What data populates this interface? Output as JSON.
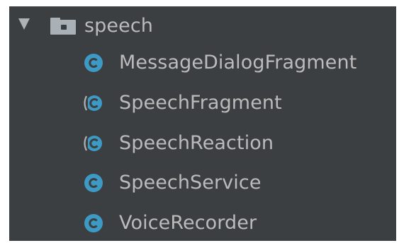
{
  "tree": {
    "folder": {
      "name": "speech",
      "icon": "folder-icon",
      "toggle_icon": "chevron-down-icon"
    },
    "classes": [
      {
        "name": "MessageDialogFragment",
        "icon": "class-icon",
        "abstract": false
      },
      {
        "name": "SpeechFragment",
        "icon": "abstract-class-icon",
        "abstract": true
      },
      {
        "name": "SpeechReaction",
        "icon": "abstract-class-icon",
        "abstract": true
      },
      {
        "name": "SpeechService",
        "icon": "class-icon",
        "abstract": false
      },
      {
        "name": "VoiceRecorder",
        "icon": "class-icon",
        "abstract": false
      }
    ]
  },
  "colors": {
    "background": "#3c3f41",
    "text": "#bbbbbb",
    "class_icon": "#3d9ac4",
    "folder_icon": "#a9b0b6"
  }
}
